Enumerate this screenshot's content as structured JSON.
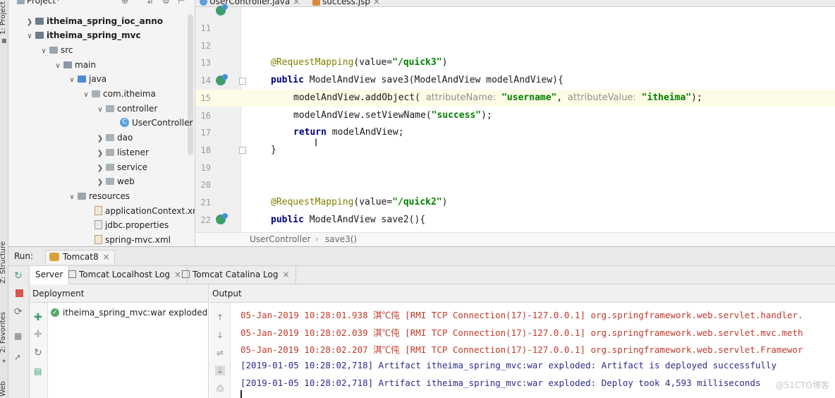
{
  "left_strip": {
    "labels": [
      "1: Project",
      "Z: Structure",
      "2: Favorites",
      "Web"
    ]
  },
  "project_tree": {
    "header": "Project",
    "nodes": [
      {
        "label": "itheima_spring_ioc_anno"
      },
      {
        "label": "itheima_spring_mvc"
      },
      {
        "label": "src"
      },
      {
        "label": "main"
      },
      {
        "label": "java"
      },
      {
        "label": "com.itheima"
      },
      {
        "label": "controller"
      },
      {
        "label": "UserController"
      },
      {
        "label": "dao"
      },
      {
        "label": "listener"
      },
      {
        "label": "service"
      },
      {
        "label": "web"
      },
      {
        "label": "resources"
      },
      {
        "label": "applicationContext.xm"
      },
      {
        "label": "jdbc.properties"
      },
      {
        "label": "spring-mvc.xml"
      }
    ]
  },
  "editor": {
    "tabs": [
      {
        "label": "UserController.java"
      },
      {
        "label": "success.jsp"
      }
    ],
    "line_numbers": [
      "11",
      "12",
      "13",
      "14",
      "15",
      "16",
      "17",
      "18",
      "19",
      "20",
      "21",
      "22"
    ],
    "lines": {
      "l13_ann": "@RequestMapping",
      "l13_rest": "(value=",
      "l13_str": "\"/quick3\"",
      "l13_end": ")",
      "l14_kw": "public",
      "l14_rest": " ModelAndView save3(ModelAndView modelAndView){",
      "l15_a": "modelAndView.addObject(",
      "l15_hint1": "attributeName:",
      "l15_str1": "\"username\"",
      "l15_comma": ",",
      "l15_hint2": "attributeValue:",
      "l15_str2": "\"itheima\"",
      "l15_end": ");",
      "l16_a": "modelAndView.setViewName(",
      "l16_str": "\"success\"",
      "l16_end": ");",
      "l17_kw": "return",
      "l17_rest": " modelAndView;",
      "l18": "}",
      "l21_ann": "@RequestMapping",
      "l21_rest": "(value=",
      "l21_str": "\"/quick2\"",
      "l21_end": ")",
      "l22_kw": "public",
      "l22_rest": " ModelAndView save2(){"
    },
    "breadcrumb": [
      "UserController",
      "save3()"
    ]
  },
  "run_panel": {
    "run_label": "Run:",
    "config": "Tomcat8",
    "subtabs": [
      "Server",
      "Tomcat Localhost Log",
      "Tomcat Catalina Log"
    ],
    "deployment_header": "Deployment",
    "artifact": "itheima_spring_mvc:war exploded",
    "output_header": "Output",
    "log_lines": [
      "05-Jan-2019 10:28:01.938 淇℃伅 [RMI TCP Connection(17)-127.0.0.1] org.springframework.web.servlet.handler.",
      "05-Jan-2019 10:28:02.039 淇℃伅 [RMI TCP Connection(17)-127.0.0.1] org.springframework.web.servlet.mvc.meth",
      "05-Jan-2019 10:28:02.207 淇℃伅 [RMI TCP Connection(17)-127.0.0.1] org.springframework.web.servlet.Framewor",
      "[2019-01-05 10:28:02,718] Artifact itheima_spring_mvc:war exploded: Artifact is deployed successfully",
      "[2019-01-05 10:28:02,718] Artifact itheima_spring_mvc:war exploded: Deploy took 4,593 milliseconds"
    ],
    "watermark": "@51CTO博客"
  }
}
